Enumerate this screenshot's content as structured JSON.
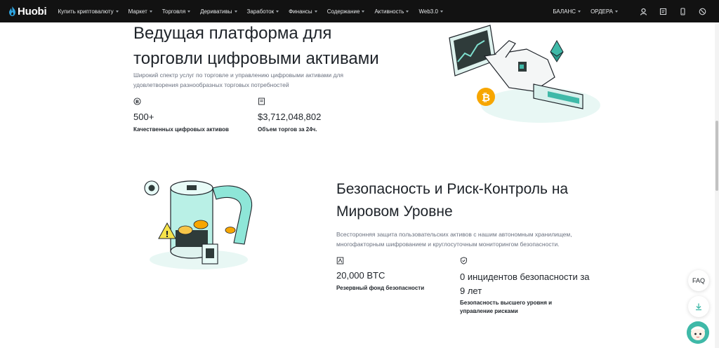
{
  "nav": {
    "logo": "Huobi",
    "items": [
      {
        "label": "Купить криптовалюту"
      },
      {
        "label": "Маркет"
      },
      {
        "label": "Торговля"
      },
      {
        "label": "Деривативы"
      },
      {
        "label": "Заработок"
      },
      {
        "label": "Финансы"
      },
      {
        "label": "Содержание"
      },
      {
        "label": "Активность"
      },
      {
        "label": "Web3.0"
      }
    ],
    "right_items": [
      {
        "label": "БАЛАНС"
      },
      {
        "label": "ОРДЕРА"
      }
    ],
    "icons": [
      "user-icon",
      "notification-icon",
      "mobile-download-icon",
      "language-icon"
    ]
  },
  "section1": {
    "title": "Ведущая платформа для торговли цифровыми активами",
    "description": "Широкий спектр услуг по торговле и управлению цифровыми активами для удовлетворения разнообразных торговых потребностей",
    "stats": [
      {
        "icon": "bitcoin-icon",
        "value": "500+",
        "label": "Качественных цифровых активов"
      },
      {
        "icon": "document-icon",
        "value": "$3,712,048,802",
        "label": "Объем торгов за 24ч."
      }
    ]
  },
  "section2": {
    "title": "Безопасность и Риск-Контроль на Мировом Уровне",
    "description": "Всесторонняя защита пользовательских активов с нашим автономным хранилищем, многофакторным шифрованием и круглосуточным мониторингом безопасности.",
    "stats": [
      {
        "icon": "reserve-icon",
        "value": "20,000 BTC",
        "label": "Резервный фонд безопасности"
      },
      {
        "icon": "shield-icon",
        "value": "0 инцидентов безопасности за 9 лет",
        "label": "Безопасность высшего уровня и управление рисками"
      }
    ]
  },
  "side": {
    "faq_label": "FAQ"
  },
  "colors": {
    "nav_bg": "#121212",
    "accent": "#3fb9a8",
    "bitcoin": "#f7a600"
  }
}
